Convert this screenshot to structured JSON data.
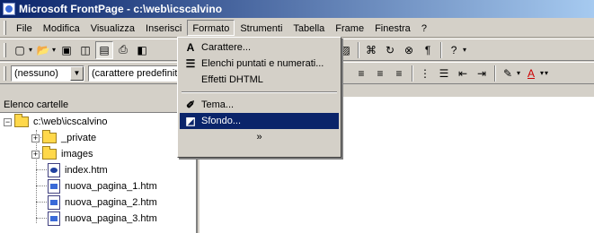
{
  "window": {
    "title": "Microsoft FrontPage - c:\\web\\icscalvino"
  },
  "menubar": {
    "items": [
      {
        "label": "File"
      },
      {
        "label": "Modifica"
      },
      {
        "label": "Visualizza"
      },
      {
        "label": "Inserisci"
      },
      {
        "label": "Formato"
      },
      {
        "label": "Strumenti"
      },
      {
        "label": "Tabella"
      },
      {
        "label": "Frame"
      },
      {
        "label": "Finestra"
      },
      {
        "label": "?"
      }
    ]
  },
  "toolbar_format": {
    "style_value": "(nessuno)",
    "font_value": "(carattere predefinito)"
  },
  "format_menu": {
    "items": [
      {
        "label": "Carattere...",
        "icon": "font-icon"
      },
      {
        "label": "Elenchi puntati e numerati...",
        "icon": "bulleted-list-icon"
      },
      {
        "label": "Effetti DHTML",
        "icon": ""
      },
      {
        "label": "Tema...",
        "icon": "theme-brush-icon"
      },
      {
        "label": "Sfondo...",
        "icon": "background-icon",
        "highlighted": true
      }
    ],
    "more": "»"
  },
  "folder_panel": {
    "title": "Elenco cartelle",
    "tree": [
      {
        "label": "c:\\web\\icscalvino",
        "type": "web-folder",
        "expander": "−"
      },
      {
        "label": "_private",
        "type": "folder",
        "expander": "+"
      },
      {
        "label": "images",
        "type": "folder",
        "expander": "+"
      },
      {
        "label": "index.htm",
        "type": "home-page"
      },
      {
        "label": "nuova_pagina_1.htm",
        "type": "page"
      },
      {
        "label": "nuova_pagina_2.htm",
        "type": "page"
      },
      {
        "label": "nuova_pagina_3.htm",
        "type": "page"
      }
    ]
  },
  "colors": {
    "title_start": "#0a246a",
    "title_end": "#a6caf0",
    "highlight": "#0a246a",
    "face": "#d4d0c8"
  }
}
